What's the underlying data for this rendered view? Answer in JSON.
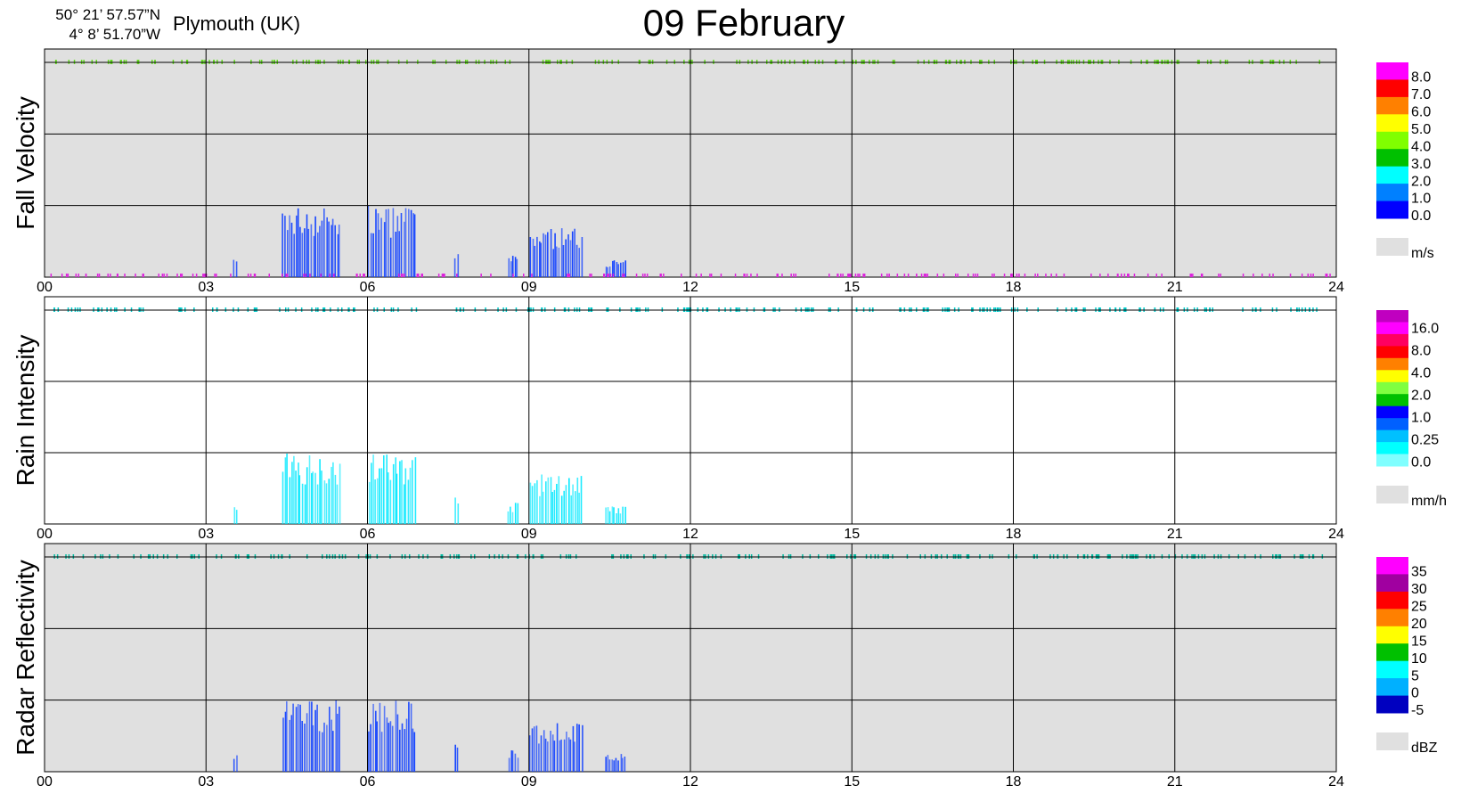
{
  "header": {
    "lat": "50° 21’ 57.57”N",
    "lon": "4°  8’ 51.70”W",
    "location": "Plymouth (UK)",
    "title": "09 February"
  },
  "colors": {
    "panel_gray": "#e0e0e0",
    "grid": "#000000"
  },
  "chart_data": [
    {
      "type": "heatmap",
      "ylabel": "Fall Velocity",
      "background": "#e0e0e0",
      "xlim": [
        0,
        24
      ],
      "x_ticks": [
        "00",
        "03",
        "06",
        "09",
        "12",
        "15",
        "18",
        "21",
        "24"
      ],
      "colorbar": {
        "unit": "m/s",
        "labels": [
          "8.0",
          "7.0",
          "6.0",
          "5.0",
          "4.0",
          "3.0",
          "2.0",
          "1.0",
          "0.0"
        ],
        "colors": [
          "#ff00ff",
          "#ff0000",
          "#ff8000",
          "#ffff00",
          "#80ff00",
          "#00c000",
          "#00ffff",
          "#0080ff",
          "#0000ff"
        ]
      },
      "rain_events": [
        {
          "start": 3.5,
          "end": 3.6,
          "intensity": 0.25,
          "color": "#1040ff"
        },
        {
          "start": 4.4,
          "end": 5.5,
          "intensity": 1.0,
          "color": "#1040ff"
        },
        {
          "start": 6.0,
          "end": 6.9,
          "intensity": 1.0,
          "color": "#1040ff"
        },
        {
          "start": 7.6,
          "end": 7.7,
          "intensity": 0.4,
          "color": "#1040ff"
        },
        {
          "start": 8.6,
          "end": 8.8,
          "intensity": 0.3,
          "color": "#1040ff"
        },
        {
          "start": 9.0,
          "end": 10.0,
          "intensity": 0.7,
          "color": "#1040ff"
        },
        {
          "start": 10.4,
          "end": 10.8,
          "intensity": 0.25,
          "color": "#1040ff"
        }
      ],
      "top_band_color": "#66dd22",
      "bottom_band_color": "#dd22dd"
    },
    {
      "type": "heatmap",
      "ylabel": "Rain Intensity",
      "background": "#ffffff",
      "xlim": [
        0,
        24
      ],
      "x_ticks": [
        "00",
        "03",
        "06",
        "09",
        "12",
        "15",
        "18",
        "21",
        "24"
      ],
      "colorbar": {
        "unit": "mm/h",
        "labels": [
          "16.0",
          "8.0",
          "4.0",
          "2.0",
          "1.0",
          "0.25",
          "0.0"
        ],
        "colors": [
          "#c000c0",
          "#ff00ff",
          "#ff0060",
          "#ff0000",
          "#ff8000",
          "#ffff00",
          "#80ff40",
          "#00c000",
          "#0000ff",
          "#0060ff",
          "#00c0ff",
          "#00ffff",
          "#80ffff"
        ]
      },
      "rain_events": [
        {
          "start": 3.5,
          "end": 3.6,
          "intensity": 0.25,
          "color": "#00e8ff"
        },
        {
          "start": 4.4,
          "end": 5.5,
          "intensity": 1.0,
          "color": "#00e8ff"
        },
        {
          "start": 6.0,
          "end": 6.9,
          "intensity": 1.0,
          "color": "#00e8ff"
        },
        {
          "start": 7.6,
          "end": 7.7,
          "intensity": 0.4,
          "color": "#00e8ff"
        },
        {
          "start": 8.6,
          "end": 8.8,
          "intensity": 0.3,
          "color": "#00e8ff"
        },
        {
          "start": 9.0,
          "end": 10.0,
          "intensity": 0.7,
          "color": "#00e8ff"
        },
        {
          "start": 10.4,
          "end": 10.8,
          "intensity": 0.25,
          "color": "#00e8ff"
        }
      ],
      "top_band_color": "#00c8c8",
      "bottom_band_color": ""
    },
    {
      "type": "heatmap",
      "ylabel": "Radar Reflectivity",
      "background": "#e0e0e0",
      "xlim": [
        0,
        24
      ],
      "x_ticks": [
        "00",
        "03",
        "06",
        "09",
        "12",
        "15",
        "18",
        "21",
        "24"
      ],
      "colorbar": {
        "unit": "dBZ",
        "labels": [
          "35",
          "30",
          "25",
          "20",
          "15",
          "10",
          "5",
          "0",
          "-5"
        ],
        "colors": [
          "#ff00ff",
          "#a000a0",
          "#ff0000",
          "#ff8000",
          "#ffff00",
          "#00c000",
          "#00ffff",
          "#00b0ff",
          "#0000c0"
        ]
      },
      "rain_events": [
        {
          "start": 3.5,
          "end": 3.6,
          "intensity": 0.25,
          "color": "#1040ff"
        },
        {
          "start": 4.4,
          "end": 5.5,
          "intensity": 1.0,
          "color": "#1040ff"
        },
        {
          "start": 6.0,
          "end": 6.9,
          "intensity": 1.0,
          "color": "#1040ff"
        },
        {
          "start": 7.6,
          "end": 7.7,
          "intensity": 0.4,
          "color": "#1040ff"
        },
        {
          "start": 8.6,
          "end": 8.8,
          "intensity": 0.3,
          "color": "#1040ff"
        },
        {
          "start": 9.0,
          "end": 10.0,
          "intensity": 0.7,
          "color": "#1040ff"
        },
        {
          "start": 10.4,
          "end": 10.8,
          "intensity": 0.25,
          "color": "#1040ff"
        }
      ],
      "top_band_color": "#00b8a0",
      "bottom_band_color": ""
    }
  ]
}
